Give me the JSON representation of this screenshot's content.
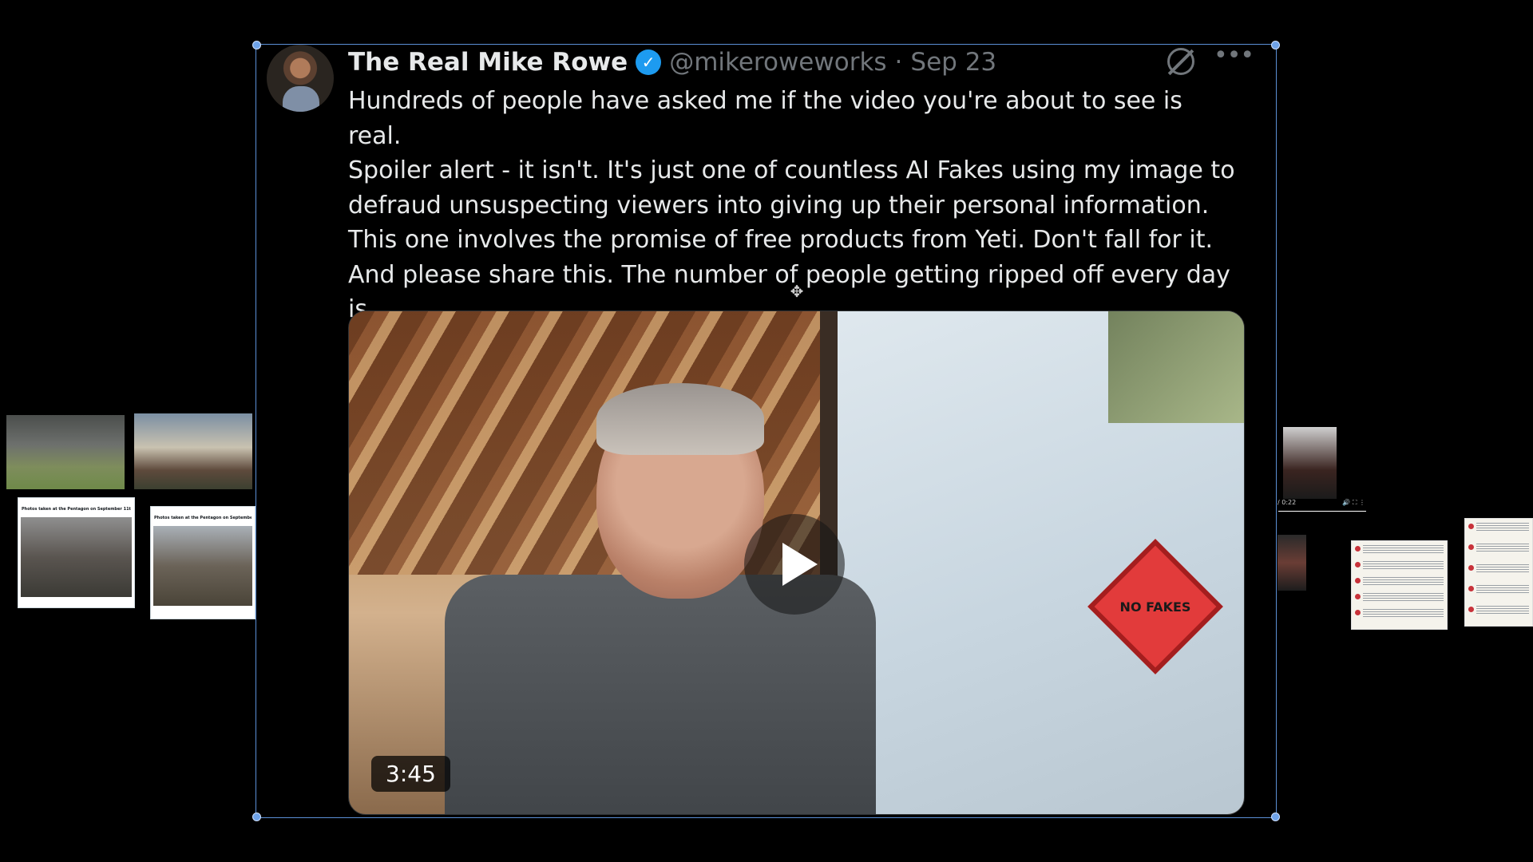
{
  "tweet": {
    "display_name": "The Real Mike Rowe",
    "verified_mark": "✓",
    "handle": "@mikeroweworks",
    "separator": "·",
    "date": "Sep 23",
    "more_glyph": "•••",
    "text": "Hundreds of people have asked me if the video you're about to see is real.\nSpoiler alert - it isn't. It's just one of countless AI Fakes using my image to\ndefraud unsuspecting viewers into giving up their personal information.\nThis one involves the promise of free products from Yeti. Don't fall for it.\nAnd please share this. The number of people getting ripped off every day is\nextraordinary."
  },
  "video": {
    "duration": "3:45",
    "sign_text": "NO FAKES"
  },
  "side_left": {
    "card1_title": "Photos taken at the Pentagon on September 11th",
    "card2_title": "Photos taken at the Pentagon on September 11th"
  },
  "side_right": {
    "player_time": "/ 0:22",
    "player_icons": "🔊 ⛶ ⋮"
  },
  "icons": {
    "move": "✥"
  },
  "colors": {
    "background": "#000000",
    "verified": "#1d9bf0",
    "muted_text": "#71767b",
    "selection_border": "#5b8fd6"
  }
}
